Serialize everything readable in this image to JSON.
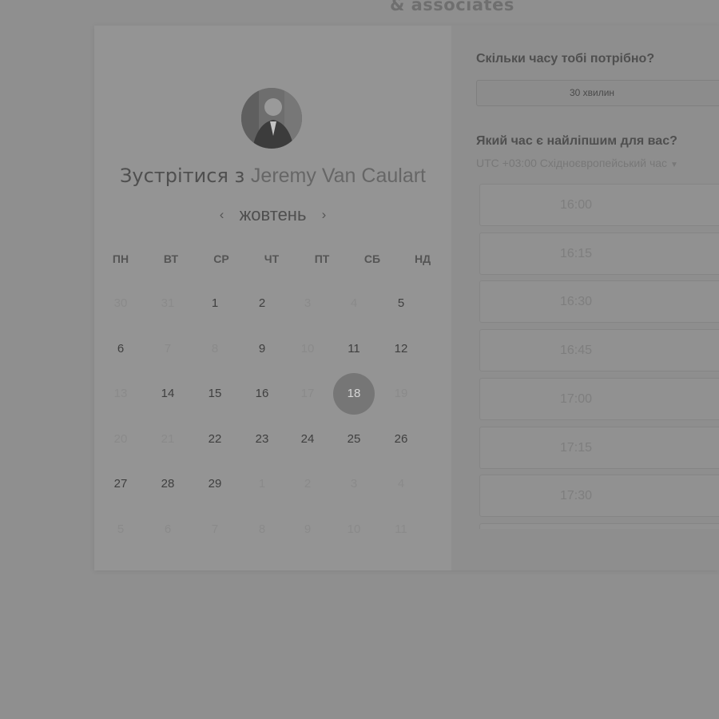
{
  "brand": {
    "logo_text": "& associates"
  },
  "meeting": {
    "title_prefix": "Зустрітися з",
    "host_name": "Jeremy Van Caulart"
  },
  "calendar": {
    "month": "жовтень",
    "weekdays": [
      "ПН",
      "ВТ",
      "СР",
      "ЧТ",
      "ПТ",
      "СБ",
      "НД"
    ],
    "weeks": [
      [
        {
          "d": "30",
          "s": "muted"
        },
        {
          "d": "31",
          "s": "muted"
        },
        {
          "d": "1",
          "s": "available"
        },
        {
          "d": "2",
          "s": "available"
        },
        {
          "d": "3",
          "s": "muted"
        },
        {
          "d": "4",
          "s": "muted"
        },
        {
          "d": "5",
          "s": "available"
        }
      ],
      [
        {
          "d": "6",
          "s": "available"
        },
        {
          "d": "7",
          "s": "muted"
        },
        {
          "d": "8",
          "s": "muted"
        },
        {
          "d": "9",
          "s": "available"
        },
        {
          "d": "10",
          "s": "muted"
        },
        {
          "d": "11",
          "s": "available"
        },
        {
          "d": "12",
          "s": "available"
        }
      ],
      [
        {
          "d": "13",
          "s": "muted"
        },
        {
          "d": "14",
          "s": "available"
        },
        {
          "d": "15",
          "s": "available"
        },
        {
          "d": "16",
          "s": "available"
        },
        {
          "d": "17",
          "s": "muted"
        },
        {
          "d": "18",
          "s": "selected"
        },
        {
          "d": "19",
          "s": "muted"
        }
      ],
      [
        {
          "d": "20",
          "s": "muted"
        },
        {
          "d": "21",
          "s": "muted"
        },
        {
          "d": "22",
          "s": "available"
        },
        {
          "d": "23",
          "s": "available"
        },
        {
          "d": "24",
          "s": "available"
        },
        {
          "d": "25",
          "s": "available"
        },
        {
          "d": "26",
          "s": "available"
        }
      ],
      [
        {
          "d": "27",
          "s": "available"
        },
        {
          "d": "28",
          "s": "available"
        },
        {
          "d": "29",
          "s": "available"
        },
        {
          "d": "1",
          "s": "muted"
        },
        {
          "d": "2",
          "s": "muted"
        },
        {
          "d": "3",
          "s": "muted"
        },
        {
          "d": "4",
          "s": "muted"
        }
      ],
      [
        {
          "d": "5",
          "s": "muted"
        },
        {
          "d": "6",
          "s": "muted"
        },
        {
          "d": "7",
          "s": "muted"
        },
        {
          "d": "8",
          "s": "muted"
        },
        {
          "d": "9",
          "s": "muted"
        },
        {
          "d": "10",
          "s": "muted"
        },
        {
          "d": "11",
          "s": "muted"
        }
      ]
    ]
  },
  "booking": {
    "duration_question": "Скільки часу тобі потрібно?",
    "duration_selected": "30 хвилин",
    "time_question": "Який час є найліпшим для вас?",
    "timezone": "UTC +03:00 Східноєвропейський час",
    "slots": [
      "16:00",
      "16:15",
      "16:30",
      "16:45",
      "17:00",
      "17:15",
      "17:30",
      ""
    ]
  },
  "colors": {
    "selected_day_bg": "#767676",
    "page_bg": "#8f8f8f"
  },
  "icons": {
    "prev": "chevron-left-icon",
    "next": "chevron-right-icon",
    "tz_caret": "caret-down-icon"
  }
}
